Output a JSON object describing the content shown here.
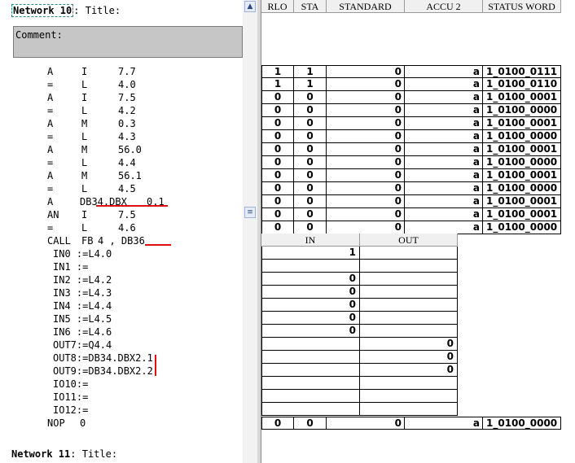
{
  "network10": {
    "label": "Network 10",
    "sep": ":",
    "title_label": "Title:"
  },
  "network11": {
    "label": "Network 11",
    "sep": ":",
    "title_label": "Title:"
  },
  "comment": {
    "label": "Comment:"
  },
  "code_lines": [
    {
      "op": "A",
      "type": "I",
      "addr": "7.7"
    },
    {
      "op": "=",
      "type": "L",
      "addr": "4.0"
    },
    {
      "op": "A",
      "type": "I",
      "addr": "7.5"
    },
    {
      "op": "=",
      "type": "L",
      "addr": "4.2"
    },
    {
      "op": "A",
      "type": "M",
      "addr": "0.3"
    },
    {
      "op": "=",
      "type": "L",
      "addr": "4.3"
    },
    {
      "op": "A",
      "type": "M",
      "addr": "56.0"
    },
    {
      "op": "=",
      "type": "L",
      "addr": "4.4"
    },
    {
      "op": "A",
      "type": "M",
      "addr": "56.1"
    },
    {
      "op": "=",
      "type": "L",
      "addr": "4.5"
    },
    {
      "op": "A",
      "type": "DB34.DBX",
      "addr": "0.1"
    },
    {
      "op": "AN",
      "type": "I",
      "addr": "7.5"
    },
    {
      "op": "=",
      "type": "L",
      "addr": "4.6"
    },
    {
      "op": "CALL",
      "type": "FB",
      "addr": "4 , DB36"
    }
  ],
  "call_params": [
    "IN0 :=L4.0",
    "IN1 :=",
    "IN2 :=L4.2",
    "IN3 :=L4.3",
    "IN4 :=L4.4",
    "IN5 :=L4.5",
    "IN6 :=L4.6",
    "OUT7:=Q4.4",
    "OUT8:=DB34.DBX2.1",
    "OUT9:=DB34.DBX2.2",
    "IO10:=",
    "IO11:=",
    "IO12:="
  ],
  "nop_line": {
    "op": "NOP",
    "arg": "0"
  },
  "status_headers": [
    "RLO",
    "STA",
    "STANDARD",
    "ACCU 2",
    "STATUS WORD"
  ],
  "status_rows": [
    [
      "1",
      "1",
      "0",
      "a",
      "1_0100_0111"
    ],
    [
      "1",
      "1",
      "0",
      "a",
      "1_0100_0110"
    ],
    [
      "0",
      "0",
      "0",
      "a",
      "1_0100_0001"
    ],
    [
      "0",
      "0",
      "0",
      "a",
      "1_0100_0000"
    ],
    [
      "0",
      "0",
      "0",
      "a",
      "1_0100_0001"
    ],
    [
      "0",
      "0",
      "0",
      "a",
      "1_0100_0000"
    ],
    [
      "0",
      "0",
      "0",
      "a",
      "1_0100_0001"
    ],
    [
      "0",
      "0",
      "0",
      "a",
      "1_0100_0000"
    ],
    [
      "0",
      "0",
      "0",
      "a",
      "1_0100_0001"
    ],
    [
      "0",
      "0",
      "0",
      "a",
      "1_0100_0000"
    ],
    [
      "0",
      "0",
      "0",
      "a",
      "1_0100_0001"
    ],
    [
      "0",
      "0",
      "0",
      "a",
      "1_0100_0001"
    ],
    [
      "0",
      "0",
      "0",
      "a",
      "1_0100_0000"
    ]
  ],
  "io_headers": [
    "IN",
    "OUT"
  ],
  "io_rows": [
    [
      "1",
      ""
    ],
    [
      "",
      ""
    ],
    [
      "0",
      ""
    ],
    [
      "0",
      ""
    ],
    [
      "0",
      ""
    ],
    [
      "0",
      ""
    ],
    [
      "0",
      ""
    ],
    [
      "",
      "0"
    ],
    [
      "",
      "0"
    ],
    [
      "",
      "0"
    ],
    [
      "",
      ""
    ],
    [
      "",
      ""
    ],
    [
      "",
      ""
    ]
  ],
  "nop_status_row": [
    "0",
    "0",
    "0",
    "a",
    "1_0100_0000"
  ],
  "annotation_color": "#e01010"
}
